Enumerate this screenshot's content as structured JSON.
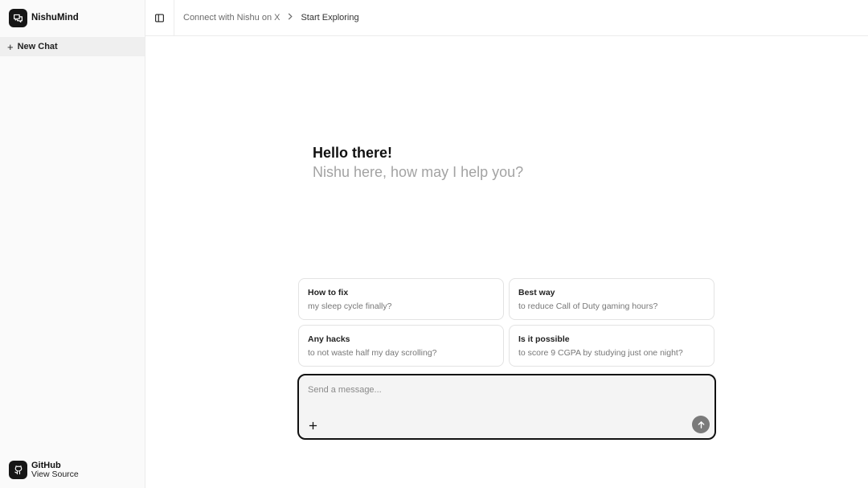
{
  "sidebar": {
    "brand_name": "NishuMind",
    "new_chat_label": "New Chat",
    "footer": {
      "title": "GitHub",
      "subtitle": "View Source"
    }
  },
  "header": {
    "breadcrumb": {
      "link": "Connect with Nishu on X",
      "current": "Start Exploring"
    }
  },
  "greeting": {
    "title": "Hello there!",
    "subtitle": "Nishu here, how may I help you?"
  },
  "suggestions": [
    {
      "title": "How to fix",
      "subtitle": "my sleep cycle finally?"
    },
    {
      "title": "Best way",
      "subtitle": "to reduce Call of Duty gaming hours?"
    },
    {
      "title": "Any hacks",
      "subtitle": "to not waste half my day scrolling?"
    },
    {
      "title": "Is it possible",
      "subtitle": "to score 9 CGPA by studying just one night?"
    }
  ],
  "composer": {
    "placeholder": "Send a message...",
    "value": ""
  },
  "icons": {
    "brand": "chat-bubbles-icon",
    "new_chat": "plus-icon",
    "github": "github-icon",
    "sidebar_toggle": "sidebar-toggle-icon",
    "breadcrumb_separator": "chevron-right-icon",
    "attach": "plus-icon",
    "send": "arrow-up-icon"
  }
}
